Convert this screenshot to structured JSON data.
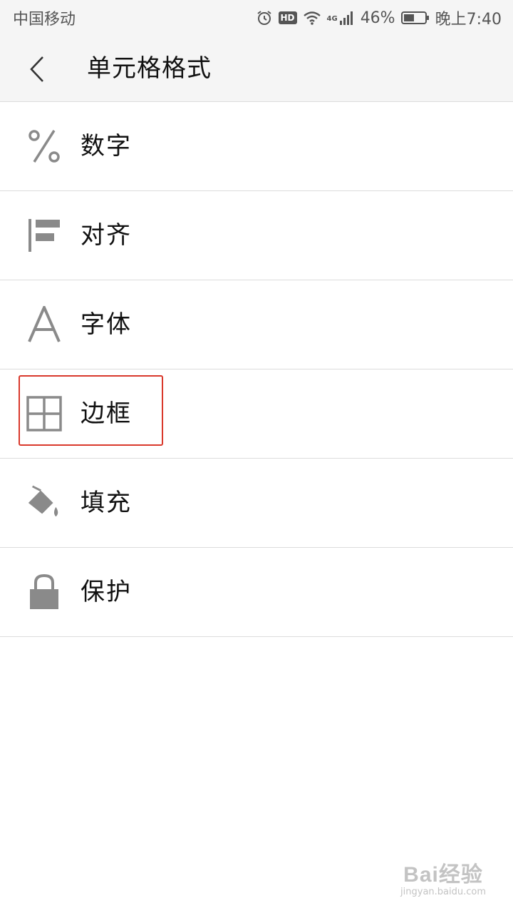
{
  "status_bar": {
    "carrier": "中国移动",
    "hd": "HD",
    "network": "4G",
    "battery": "46%",
    "time": "晚上7:40"
  },
  "header": {
    "title": "单元格格式"
  },
  "menu": {
    "items": [
      {
        "label": "数字",
        "icon": "percent-icon"
      },
      {
        "label": "对齐",
        "icon": "align-left-icon"
      },
      {
        "label": "字体",
        "icon": "font-icon"
      },
      {
        "label": "边框",
        "icon": "border-grid-icon"
      },
      {
        "label": "填充",
        "icon": "paint-bucket-icon"
      },
      {
        "label": "保护",
        "icon": "lock-icon"
      }
    ]
  },
  "highlight": {
    "target": "边框",
    "color": "#d9382b"
  },
  "watermark": {
    "main": "Bai经验",
    "sub": "jingyan.baidu.com"
  },
  "colors": {
    "icon": "#8a8a8a",
    "background_header": "#f5f5f5",
    "divider": "#dcdcdc"
  }
}
